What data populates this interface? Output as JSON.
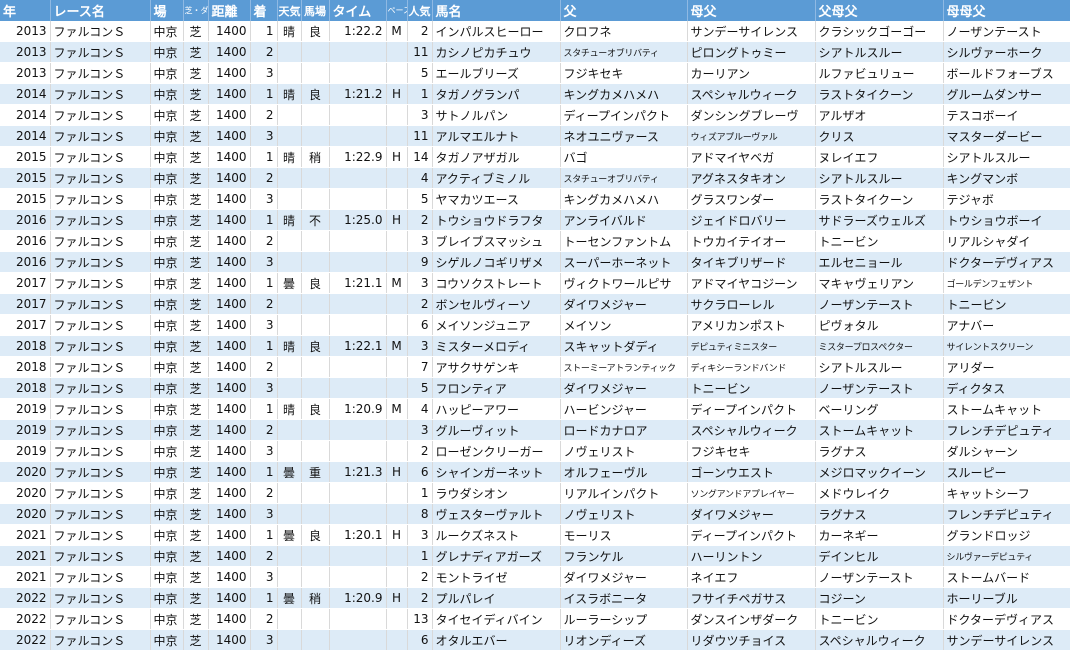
{
  "headers": {
    "year": "年",
    "race": "レース名",
    "venue": "場",
    "surface": "芝・ダ",
    "distance": "距離",
    "finish": "着",
    "weather": "天気",
    "going": "馬場",
    "time": "タイム",
    "pace": "ペース",
    "popularity": "人気",
    "horse": "馬名",
    "sire": "父",
    "dam": "母父",
    "damsire": "父母父",
    "damdamsire": "母母父"
  },
  "rows": [
    {
      "year": "2013",
      "race": "ファルコンＳ",
      "venue": "中京",
      "surface": "芝",
      "distance": "1400",
      "finish": "1",
      "weather": "晴",
      "going": "良",
      "time": "1:22.2",
      "pace": "M",
      "popularity": "2",
      "horse": "インパルスヒーロー",
      "sire": "クロフネ",
      "dam": "サンデーサイレンス",
      "damsire": "クラシックゴーゴー",
      "damdamsire": "ノーザンテースト"
    },
    {
      "year": "2013",
      "race": "ファルコンＳ",
      "venue": "中京",
      "surface": "芝",
      "distance": "1400",
      "finish": "2",
      "weather": "",
      "going": "",
      "time": "",
      "pace": "",
      "popularity": "11",
      "horse": "カシノピカチュウ",
      "sire": "スタチューオブリバティ",
      "dam": "ピロングトゥミー",
      "damsire": "シアトルスルー",
      "damdamsire": "シルヴァーホーク"
    },
    {
      "year": "2013",
      "race": "ファルコンＳ",
      "venue": "中京",
      "surface": "芝",
      "distance": "1400",
      "finish": "3",
      "weather": "",
      "going": "",
      "time": "",
      "pace": "",
      "popularity": "5",
      "horse": "エールブリーズ",
      "sire": "フジキセキ",
      "dam": "カーリアン",
      "damsire": "ルファビュリュー",
      "damdamsire": "ボールドフォーブス"
    },
    {
      "year": "2014",
      "race": "ファルコンＳ",
      "venue": "中京",
      "surface": "芝",
      "distance": "1400",
      "finish": "1",
      "weather": "晴",
      "going": "良",
      "time": "1:21.2",
      "pace": "H",
      "popularity": "1",
      "horse": "タガノグランパ",
      "sire": "キングカメハメハ",
      "dam": "スペシャルウィーク",
      "damsire": "ラストタイクーン",
      "damdamsire": "グルームダンサー"
    },
    {
      "year": "2014",
      "race": "ファルコンＳ",
      "venue": "中京",
      "surface": "芝",
      "distance": "1400",
      "finish": "2",
      "weather": "",
      "going": "",
      "time": "",
      "pace": "",
      "popularity": "3",
      "horse": "サトノルパン",
      "sire": "ディープインパクト",
      "dam": "ダンシングブレーヴ",
      "damsire": "アルザオ",
      "damdamsire": "テスコボーイ"
    },
    {
      "year": "2014",
      "race": "ファルコンＳ",
      "venue": "中京",
      "surface": "芝",
      "distance": "1400",
      "finish": "3",
      "weather": "",
      "going": "",
      "time": "",
      "pace": "",
      "popularity": "11",
      "horse": "アルマエルナト",
      "sire": "ネオユニヴァース",
      "dam": "ウィズアプルーヴァル",
      "damsire": "クリス",
      "damdamsire": "マスターダービー"
    },
    {
      "year": "2015",
      "race": "ファルコンＳ",
      "venue": "中京",
      "surface": "芝",
      "distance": "1400",
      "finish": "1",
      "weather": "晴",
      "going": "稍",
      "time": "1:22.9",
      "pace": "H",
      "popularity": "14",
      "horse": "タガノアザガル",
      "sire": "バゴ",
      "dam": "アドマイヤベガ",
      "damsire": "ヌレイエフ",
      "damdamsire": "シアトルスルー"
    },
    {
      "year": "2015",
      "race": "ファルコンＳ",
      "venue": "中京",
      "surface": "芝",
      "distance": "1400",
      "finish": "2",
      "weather": "",
      "going": "",
      "time": "",
      "pace": "",
      "popularity": "4",
      "horse": "アクティブミノル",
      "sire": "スタチューオブリバティ",
      "dam": "アグネスタキオン",
      "damsire": "シアトルスルー",
      "damdamsire": "キングマンボ"
    },
    {
      "year": "2015",
      "race": "ファルコンＳ",
      "venue": "中京",
      "surface": "芝",
      "distance": "1400",
      "finish": "3",
      "weather": "",
      "going": "",
      "time": "",
      "pace": "",
      "popularity": "5",
      "horse": "ヤマカツエース",
      "sire": "キングカメハメハ",
      "dam": "グラスワンダー",
      "damsire": "ラストタイクーン",
      "damdamsire": "テジャボ"
    },
    {
      "year": "2016",
      "race": "ファルコンＳ",
      "venue": "中京",
      "surface": "芝",
      "distance": "1400",
      "finish": "1",
      "weather": "晴",
      "going": "不",
      "time": "1:25.0",
      "pace": "H",
      "popularity": "2",
      "horse": "トウショウドラフタ",
      "sire": "アンライバルド",
      "dam": "ジェイドロバリー",
      "damsire": "サドラーズウェルズ",
      "damdamsire": "トウショウボーイ"
    },
    {
      "year": "2016",
      "race": "ファルコンＳ",
      "venue": "中京",
      "surface": "芝",
      "distance": "1400",
      "finish": "2",
      "weather": "",
      "going": "",
      "time": "",
      "pace": "",
      "popularity": "3",
      "horse": "ブレイブスマッシュ",
      "sire": "トーセンファントム",
      "dam": "トウカイテイオー",
      "damsire": "トニービン",
      "damdamsire": "リアルシャダイ"
    },
    {
      "year": "2016",
      "race": "ファルコンＳ",
      "venue": "中京",
      "surface": "芝",
      "distance": "1400",
      "finish": "3",
      "weather": "",
      "going": "",
      "time": "",
      "pace": "",
      "popularity": "9",
      "horse": "シゲルノコギリザメ",
      "sire": "スーパーホーネット",
      "dam": "タイキブリザード",
      "damsire": "エルセニョール",
      "damdamsire": "ドクターデヴィアス"
    },
    {
      "year": "2017",
      "race": "ファルコンＳ",
      "venue": "中京",
      "surface": "芝",
      "distance": "1400",
      "finish": "1",
      "weather": "曇",
      "going": "良",
      "time": "1:21.1",
      "pace": "M",
      "popularity": "3",
      "horse": "コウソクストレート",
      "sire": "ヴィクトワールピサ",
      "dam": "アドマイヤコジーン",
      "damsire": "マキャヴェリアン",
      "damdamsire": "ゴールデンフェザント"
    },
    {
      "year": "2017",
      "race": "ファルコンＳ",
      "venue": "中京",
      "surface": "芝",
      "distance": "1400",
      "finish": "2",
      "weather": "",
      "going": "",
      "time": "",
      "pace": "",
      "popularity": "2",
      "horse": "ボンセルヴィーソ",
      "sire": "ダイワメジャー",
      "dam": "サクラローレル",
      "damsire": "ノーザンテースト",
      "damdamsire": "トニービン"
    },
    {
      "year": "2017",
      "race": "ファルコンＳ",
      "venue": "中京",
      "surface": "芝",
      "distance": "1400",
      "finish": "3",
      "weather": "",
      "going": "",
      "time": "",
      "pace": "",
      "popularity": "6",
      "horse": "メイソンジュニア",
      "sire": "メイソン",
      "dam": "アメリカンポスト",
      "damsire": "ピヴォタル",
      "damdamsire": "アナバー"
    },
    {
      "year": "2018",
      "race": "ファルコンＳ",
      "venue": "中京",
      "surface": "芝",
      "distance": "1400",
      "finish": "1",
      "weather": "晴",
      "going": "良",
      "time": "1:22.1",
      "pace": "M",
      "popularity": "3",
      "horse": "ミスターメロディ",
      "sire": "スキャットダディ",
      "dam": "デピュティミニスター",
      "damsire": "ミスタープロスペクター",
      "damdamsire": "サイレントスクリーン"
    },
    {
      "year": "2018",
      "race": "ファルコンＳ",
      "venue": "中京",
      "surface": "芝",
      "distance": "1400",
      "finish": "2",
      "weather": "",
      "going": "",
      "time": "",
      "pace": "",
      "popularity": "7",
      "horse": "アサクサゲンキ",
      "sire": "ストーミーアトランティック",
      "dam": "ディキシーランドバンド",
      "damsire": "シアトルスルー",
      "damdamsire": "アリダー"
    },
    {
      "year": "2018",
      "race": "ファルコンＳ",
      "venue": "中京",
      "surface": "芝",
      "distance": "1400",
      "finish": "3",
      "weather": "",
      "going": "",
      "time": "",
      "pace": "",
      "popularity": "5",
      "horse": "フロンティア",
      "sire": "ダイワメジャー",
      "dam": "トニービン",
      "damsire": "ノーザンテースト",
      "damdamsire": "ディクタス"
    },
    {
      "year": "2019",
      "race": "ファルコンＳ",
      "venue": "中京",
      "surface": "芝",
      "distance": "1400",
      "finish": "1",
      "weather": "晴",
      "going": "良",
      "time": "1:20.9",
      "pace": "M",
      "popularity": "4",
      "horse": "ハッピーアワー",
      "sire": "ハービンジャー",
      "dam": "ディープインパクト",
      "damsire": "ベーリング",
      "damdamsire": "ストームキャット"
    },
    {
      "year": "2019",
      "race": "ファルコンＳ",
      "venue": "中京",
      "surface": "芝",
      "distance": "1400",
      "finish": "2",
      "weather": "",
      "going": "",
      "time": "",
      "pace": "",
      "popularity": "3",
      "horse": "グルーヴィット",
      "sire": "ロードカナロア",
      "dam": "スペシャルウィーク",
      "damsire": "ストームキャット",
      "damdamsire": "フレンチデピュティ"
    },
    {
      "year": "2019",
      "race": "ファルコンＳ",
      "venue": "中京",
      "surface": "芝",
      "distance": "1400",
      "finish": "3",
      "weather": "",
      "going": "",
      "time": "",
      "pace": "",
      "popularity": "2",
      "horse": "ローゼンクリーガー",
      "sire": "ノヴェリスト",
      "dam": "フジキセキ",
      "damsire": "ラグナス",
      "damdamsire": "ダルシャーン"
    },
    {
      "year": "2020",
      "race": "ファルコンＳ",
      "venue": "中京",
      "surface": "芝",
      "distance": "1400",
      "finish": "1",
      "weather": "曇",
      "going": "重",
      "time": "1:21.3",
      "pace": "H",
      "popularity": "6",
      "horse": "シャインガーネット",
      "sire": "オルフェーヴル",
      "dam": "ゴーンウエスト",
      "damsire": "メジロマックイーン",
      "damdamsire": "スルーピー"
    },
    {
      "year": "2020",
      "race": "ファルコンＳ",
      "venue": "中京",
      "surface": "芝",
      "distance": "1400",
      "finish": "2",
      "weather": "",
      "going": "",
      "time": "",
      "pace": "",
      "popularity": "1",
      "horse": "ラウダシオン",
      "sire": "リアルインパクト",
      "dam": "ソングアンドアプレイヤー",
      "damsire": "メドウレイク",
      "damdamsire": "キャットシーフ"
    },
    {
      "year": "2020",
      "race": "ファルコンＳ",
      "venue": "中京",
      "surface": "芝",
      "distance": "1400",
      "finish": "3",
      "weather": "",
      "going": "",
      "time": "",
      "pace": "",
      "popularity": "8",
      "horse": "ヴェスターヴァルト",
      "sire": "ノヴェリスト",
      "dam": "ダイワメジャー",
      "damsire": "ラグナス",
      "damdamsire": "フレンチデピュティ"
    },
    {
      "year": "2021",
      "race": "ファルコンＳ",
      "venue": "中京",
      "surface": "芝",
      "distance": "1400",
      "finish": "1",
      "weather": "曇",
      "going": "良",
      "time": "1:20.1",
      "pace": "H",
      "popularity": "3",
      "horse": "ルークズネスト",
      "sire": "モーリス",
      "dam": "ディープインパクト",
      "damsire": "カーネギー",
      "damdamsire": "グランドロッジ"
    },
    {
      "year": "2021",
      "race": "ファルコンＳ",
      "venue": "中京",
      "surface": "芝",
      "distance": "1400",
      "finish": "2",
      "weather": "",
      "going": "",
      "time": "",
      "pace": "",
      "popularity": "1",
      "horse": "グレナディアガーズ",
      "sire": "フランケル",
      "dam": "ハーリントン",
      "damsire": "デインヒル",
      "damdamsire": "シルヴァーデピュティ"
    },
    {
      "year": "2021",
      "race": "ファルコンＳ",
      "venue": "中京",
      "surface": "芝",
      "distance": "1400",
      "finish": "3",
      "weather": "",
      "going": "",
      "time": "",
      "pace": "",
      "popularity": "2",
      "horse": "モントライゼ",
      "sire": "ダイワメジャー",
      "dam": "ネイエフ",
      "damsire": "ノーザンテースト",
      "damdamsire": "ストームバード"
    },
    {
      "year": "2022",
      "race": "ファルコンＳ",
      "venue": "中京",
      "surface": "芝",
      "distance": "1400",
      "finish": "1",
      "weather": "曇",
      "going": "稍",
      "time": "1:20.9",
      "pace": "H",
      "popularity": "2",
      "horse": "プルパレイ",
      "sire": "イスラボニータ",
      "dam": "フサイチペガサス",
      "damsire": "コジーン",
      "damdamsire": "ホーリーブル"
    },
    {
      "year": "2022",
      "race": "ファルコンＳ",
      "venue": "中京",
      "surface": "芝",
      "distance": "1400",
      "finish": "2",
      "weather": "",
      "going": "",
      "time": "",
      "pace": "",
      "popularity": "13",
      "horse": "タイセイディバイン",
      "sire": "ルーラーシップ",
      "dam": "ダンスインザダーク",
      "damsire": "トニービン",
      "damdamsire": "ドクターデヴィアス"
    },
    {
      "year": "2022",
      "race": "ファルコンＳ",
      "venue": "中京",
      "surface": "芝",
      "distance": "1400",
      "finish": "3",
      "weather": "",
      "going": "",
      "time": "",
      "pace": "",
      "popularity": "6",
      "horse": "オタルエバー",
      "sire": "リオンディーズ",
      "dam": "リダウツチョイス",
      "damsire": "スペシャルウィーク",
      "damdamsire": "サンデーサイレンス"
    }
  ]
}
